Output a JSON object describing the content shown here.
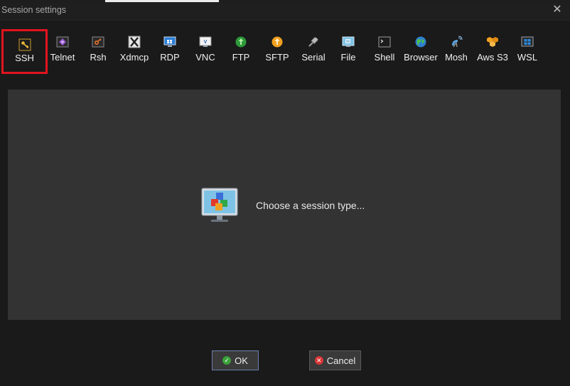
{
  "window": {
    "title": "Session settings",
    "close_symbol": "✕"
  },
  "toolbar": {
    "items": [
      {
        "label": "SSH",
        "icon": "ssh-key-icon",
        "selected": true
      },
      {
        "label": "Telnet",
        "icon": "telnet-icon"
      },
      {
        "label": "Rsh",
        "icon": "rsh-icon"
      },
      {
        "label": "Xdmcp",
        "icon": "xdmcp-icon"
      },
      {
        "label": "RDP",
        "icon": "rdp-icon"
      },
      {
        "label": "VNC",
        "icon": "vnc-icon"
      },
      {
        "label": "FTP",
        "icon": "ftp-icon"
      },
      {
        "label": "SFTP",
        "icon": "sftp-icon"
      },
      {
        "label": "Serial",
        "icon": "serial-icon"
      },
      {
        "label": "File",
        "icon": "file-icon"
      },
      {
        "label": "Shell",
        "icon": "shell-icon"
      },
      {
        "label": "Browser",
        "icon": "browser-icon"
      },
      {
        "label": "Mosh",
        "icon": "mosh-icon"
      },
      {
        "label": "Aws S3",
        "icon": "aws-s3-icon"
      },
      {
        "label": "WSL",
        "icon": "wsl-icon"
      }
    ]
  },
  "main": {
    "placeholder_text": "Choose a session type...",
    "placeholder_icon": "session-cubes-icon"
  },
  "buttons": {
    "ok_label": "OK",
    "cancel_label": "Cancel"
  },
  "colors": {
    "selection_border": "#e0141e",
    "ok_border": "#6c7fb0",
    "ok_icon": "#3aa23a",
    "cancel_icon": "#d93636"
  }
}
